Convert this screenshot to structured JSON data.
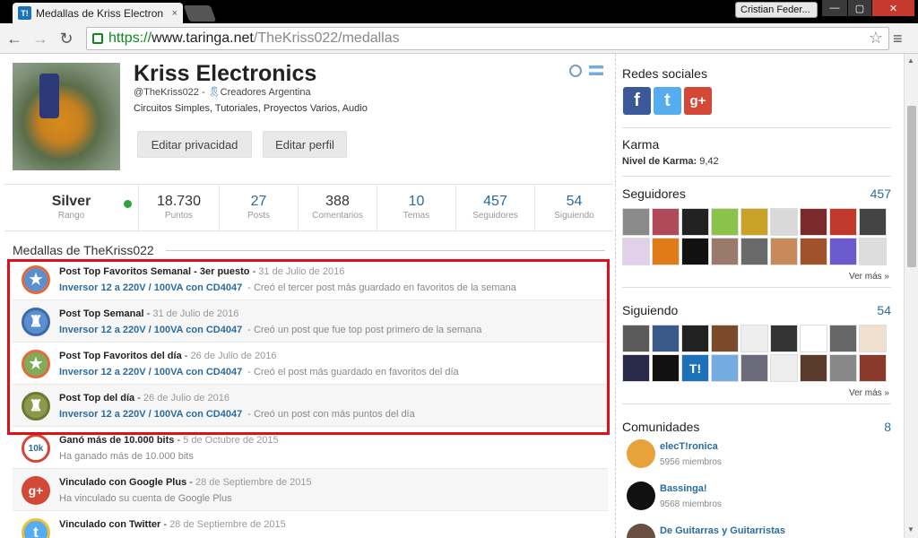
{
  "browser": {
    "tab_title": "Medallas de Kriss Electron",
    "tab_favicon": "T!",
    "tab_close": "×",
    "user_name": "Cristian Feder...",
    "url_scheme": "https://",
    "url_host": "www.taringa.net",
    "url_path": "/TheKriss022/medallas",
    "controls": {
      "min": "—",
      "max": "▢",
      "close": "✕"
    }
  },
  "profile": {
    "name": "Kriss Electronics",
    "handle": "@TheKriss022",
    "community": "Creadores Argentina",
    "description": "Circuitos Simples, Tutoriales, Proyectos Varios, Audio",
    "btn_privacy": "Editar privacidad",
    "btn_edit": "Editar perfil"
  },
  "stats": [
    {
      "value": "Silver",
      "label": "Rango"
    },
    {
      "value": "18.730",
      "label": "Puntos"
    },
    {
      "value": "27",
      "label": "Posts"
    },
    {
      "value": "388",
      "label": "Comentarios"
    },
    {
      "value": "10",
      "label": "Temas"
    },
    {
      "value": "457",
      "label": "Seguidores"
    },
    {
      "value": "54",
      "label": "Siguiendo"
    }
  ],
  "medals_title": "Medallas de TheKriss022",
  "medals": [
    {
      "title": "Post Top Favoritos Semanal - 3er puesto",
      "date": "31 de Julio de 2016",
      "link": "Inversor 12 a 220V / 100VA con CD4047",
      "desc": "- Creó el tercer post más guardado en favoritos de la semana",
      "color": "#5b8fd0",
      "glyph": "★"
    },
    {
      "title": "Post Top Semanal",
      "date": "31 de Julio de 2016",
      "link": "Inversor 12 a 220V / 100VA con CD4047",
      "desc": "- Creó un post que fue top post primero de la semana",
      "color": "#5b8fd0",
      "glyph": "🏆"
    },
    {
      "title": "Post Top Favoritos del día",
      "date": "26 de Julio de 2016",
      "link": "Inversor 12 a 220V / 100VA con CD4047",
      "desc": "- Creó el post más guardado en favoritos del día",
      "color": "#7fab5a",
      "glyph": "★"
    },
    {
      "title": "Post Top del día",
      "date": "26 de Julio de 2016",
      "link": "Inversor 12 a 220V / 100VA con CD4047",
      "desc": "- Creó un post con más puntos del día",
      "color": "#8a9a4a",
      "glyph": "🏆"
    },
    {
      "title": "Ganó más de 10.000 bits",
      "date": "5 de Octubre de 2015",
      "link": "",
      "desc": "Ha ganado más de 10.000 bits",
      "color": "#ffffff",
      "glyph": "10k"
    },
    {
      "title": "Vinculado con Google Plus",
      "date": "28 de Septiembre de 2015",
      "link": "",
      "desc": "Ha vinculado su cuenta de Google Plus",
      "color": "#d34836",
      "glyph": "g+"
    },
    {
      "title": "Vinculado con Twitter",
      "date": "28 de Septiembre de 2015",
      "link": "",
      "desc": "",
      "color": "#55acee",
      "glyph": "t"
    }
  ],
  "sidebar": {
    "social_title": "Redes sociales",
    "karma_title": "Karma",
    "karma_label": "Nivel de Karma:",
    "karma_value": "9,42",
    "followers_title": "Seguidores",
    "followers_count": "457",
    "following_title": "Siguiendo",
    "following_count": "54",
    "ver_mas": "Ver más »",
    "communities_title": "Comunidades",
    "communities_count": "8",
    "communities": [
      {
        "name": "elecT!ronica",
        "members": "5956 miembros"
      },
      {
        "name": "Bassinga!",
        "members": "9568 miembros"
      },
      {
        "name": "De Guitarras y Guitarristas",
        "members": ""
      }
    ]
  }
}
